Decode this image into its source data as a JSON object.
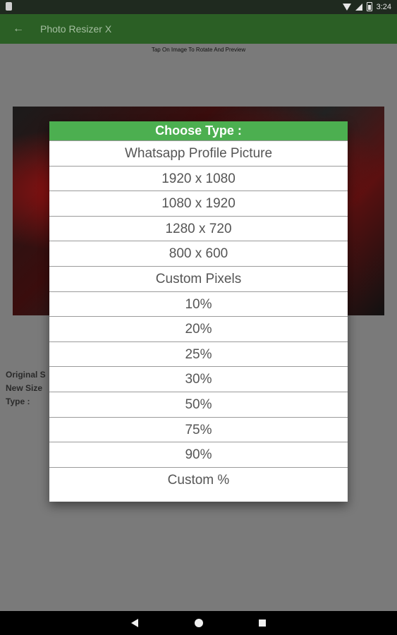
{
  "status": {
    "time": "3:24"
  },
  "toolbar": {
    "title": "Photo Resizer X"
  },
  "hint": "Tap On Image To Rotate And Preview",
  "info": {
    "original_label": "Original S",
    "new_label": "New Size",
    "type_label": "Type :"
  },
  "dialog": {
    "title": "Choose Type :",
    "options": [
      "Whatsapp Profile Picture",
      "1920 x 1080",
      "1080 x 1920",
      "1280 x 720",
      "800 x 600",
      "Custom Pixels",
      "10%",
      "20%",
      "25%",
      "30%",
      "50%",
      "75%",
      "90%",
      "Custom %"
    ]
  },
  "colors": {
    "toolbar": "#2b5f25",
    "dialog_header": "#4caf50",
    "scrim": "#7a7a7a"
  }
}
